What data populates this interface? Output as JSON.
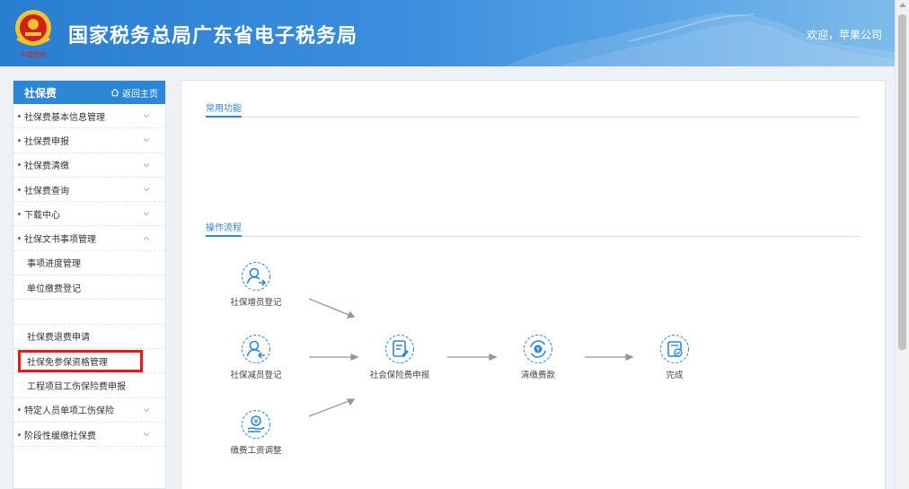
{
  "header": {
    "title": "国家税务总局广东省电子税务局",
    "welcome": "欢迎，苹果公司"
  },
  "sidebar": {
    "title": "社保费",
    "home_label": "返回主页",
    "items": [
      {
        "label": "社保费基本信息管理",
        "type": "group",
        "chevron": "down"
      },
      {
        "label": "社保费申报",
        "type": "group",
        "chevron": "down"
      },
      {
        "label": "社保费清缴",
        "type": "group",
        "chevron": "down"
      },
      {
        "label": "社保费查询",
        "type": "group",
        "chevron": "down"
      },
      {
        "label": "下载中心",
        "type": "group",
        "chevron": "down"
      },
      {
        "label": "社保文书事项管理",
        "type": "group",
        "chevron": "up"
      },
      {
        "label": "事项进度管理",
        "type": "sub"
      },
      {
        "label": "单位缴费登记",
        "type": "sub"
      },
      {
        "label": "",
        "type": "blank"
      },
      {
        "label": "社保费退费申请",
        "type": "sub",
        "highlighted": true
      },
      {
        "label": "社保免参保资格管理",
        "type": "sub"
      },
      {
        "label": "工程项目工伤保险费申报",
        "type": "sub"
      },
      {
        "label": "特定人员单项工伤保险",
        "type": "group",
        "chevron": "down"
      },
      {
        "label": "阶段性缓缴社保费",
        "type": "group",
        "chevron": "down"
      }
    ]
  },
  "main": {
    "common_title": "常用功能",
    "flow_title": "操作流程",
    "flow": {
      "add_staff": "社保增员登记",
      "reduce_staff": "社保减员登记",
      "wage_adjust": "缴费工资调整",
      "declare": "社会保险费申报",
      "pay": "清缴费款",
      "done": "完成"
    }
  },
  "colors": {
    "primary": "#2e86d6",
    "header_start": "#2a7ed0",
    "highlight": "#e11b1b"
  }
}
